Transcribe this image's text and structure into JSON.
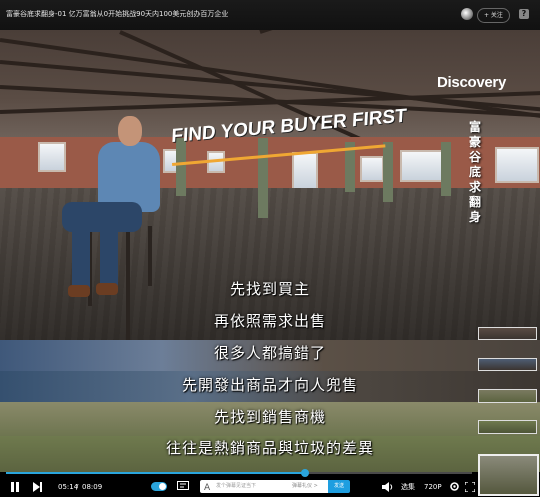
{
  "window": {
    "title": "富豪谷底求翻身-01 亿万富翁从0开始挑战90天内100美元创办百万企业",
    "follow_label": "+ 关注",
    "help_label": "?"
  },
  "video": {
    "brand": "Discovery",
    "show_title": "富豪谷底求翻身",
    "headline": "FIND YOUR BUYER FIRST"
  },
  "subtitles": [
    "先找到買主",
    "再依照需求出售",
    "很多人都搞錯了",
    "先開發出商品才向人兜售",
    "先找到銷售商機",
    "往往是熱銷商品與垃圾的差異"
  ],
  "player": {
    "current_time": "05:14",
    "total_time": "08:09",
    "time_separator": "/",
    "progress": 0.642,
    "danmu_placeholder": "发个弹幕见证当下",
    "danmu_etiquette": "弹幕礼仪 >",
    "send_label": "发送",
    "episodes_label": "选集",
    "quality_label": "720P",
    "accent_color": "#2aa5dc"
  }
}
